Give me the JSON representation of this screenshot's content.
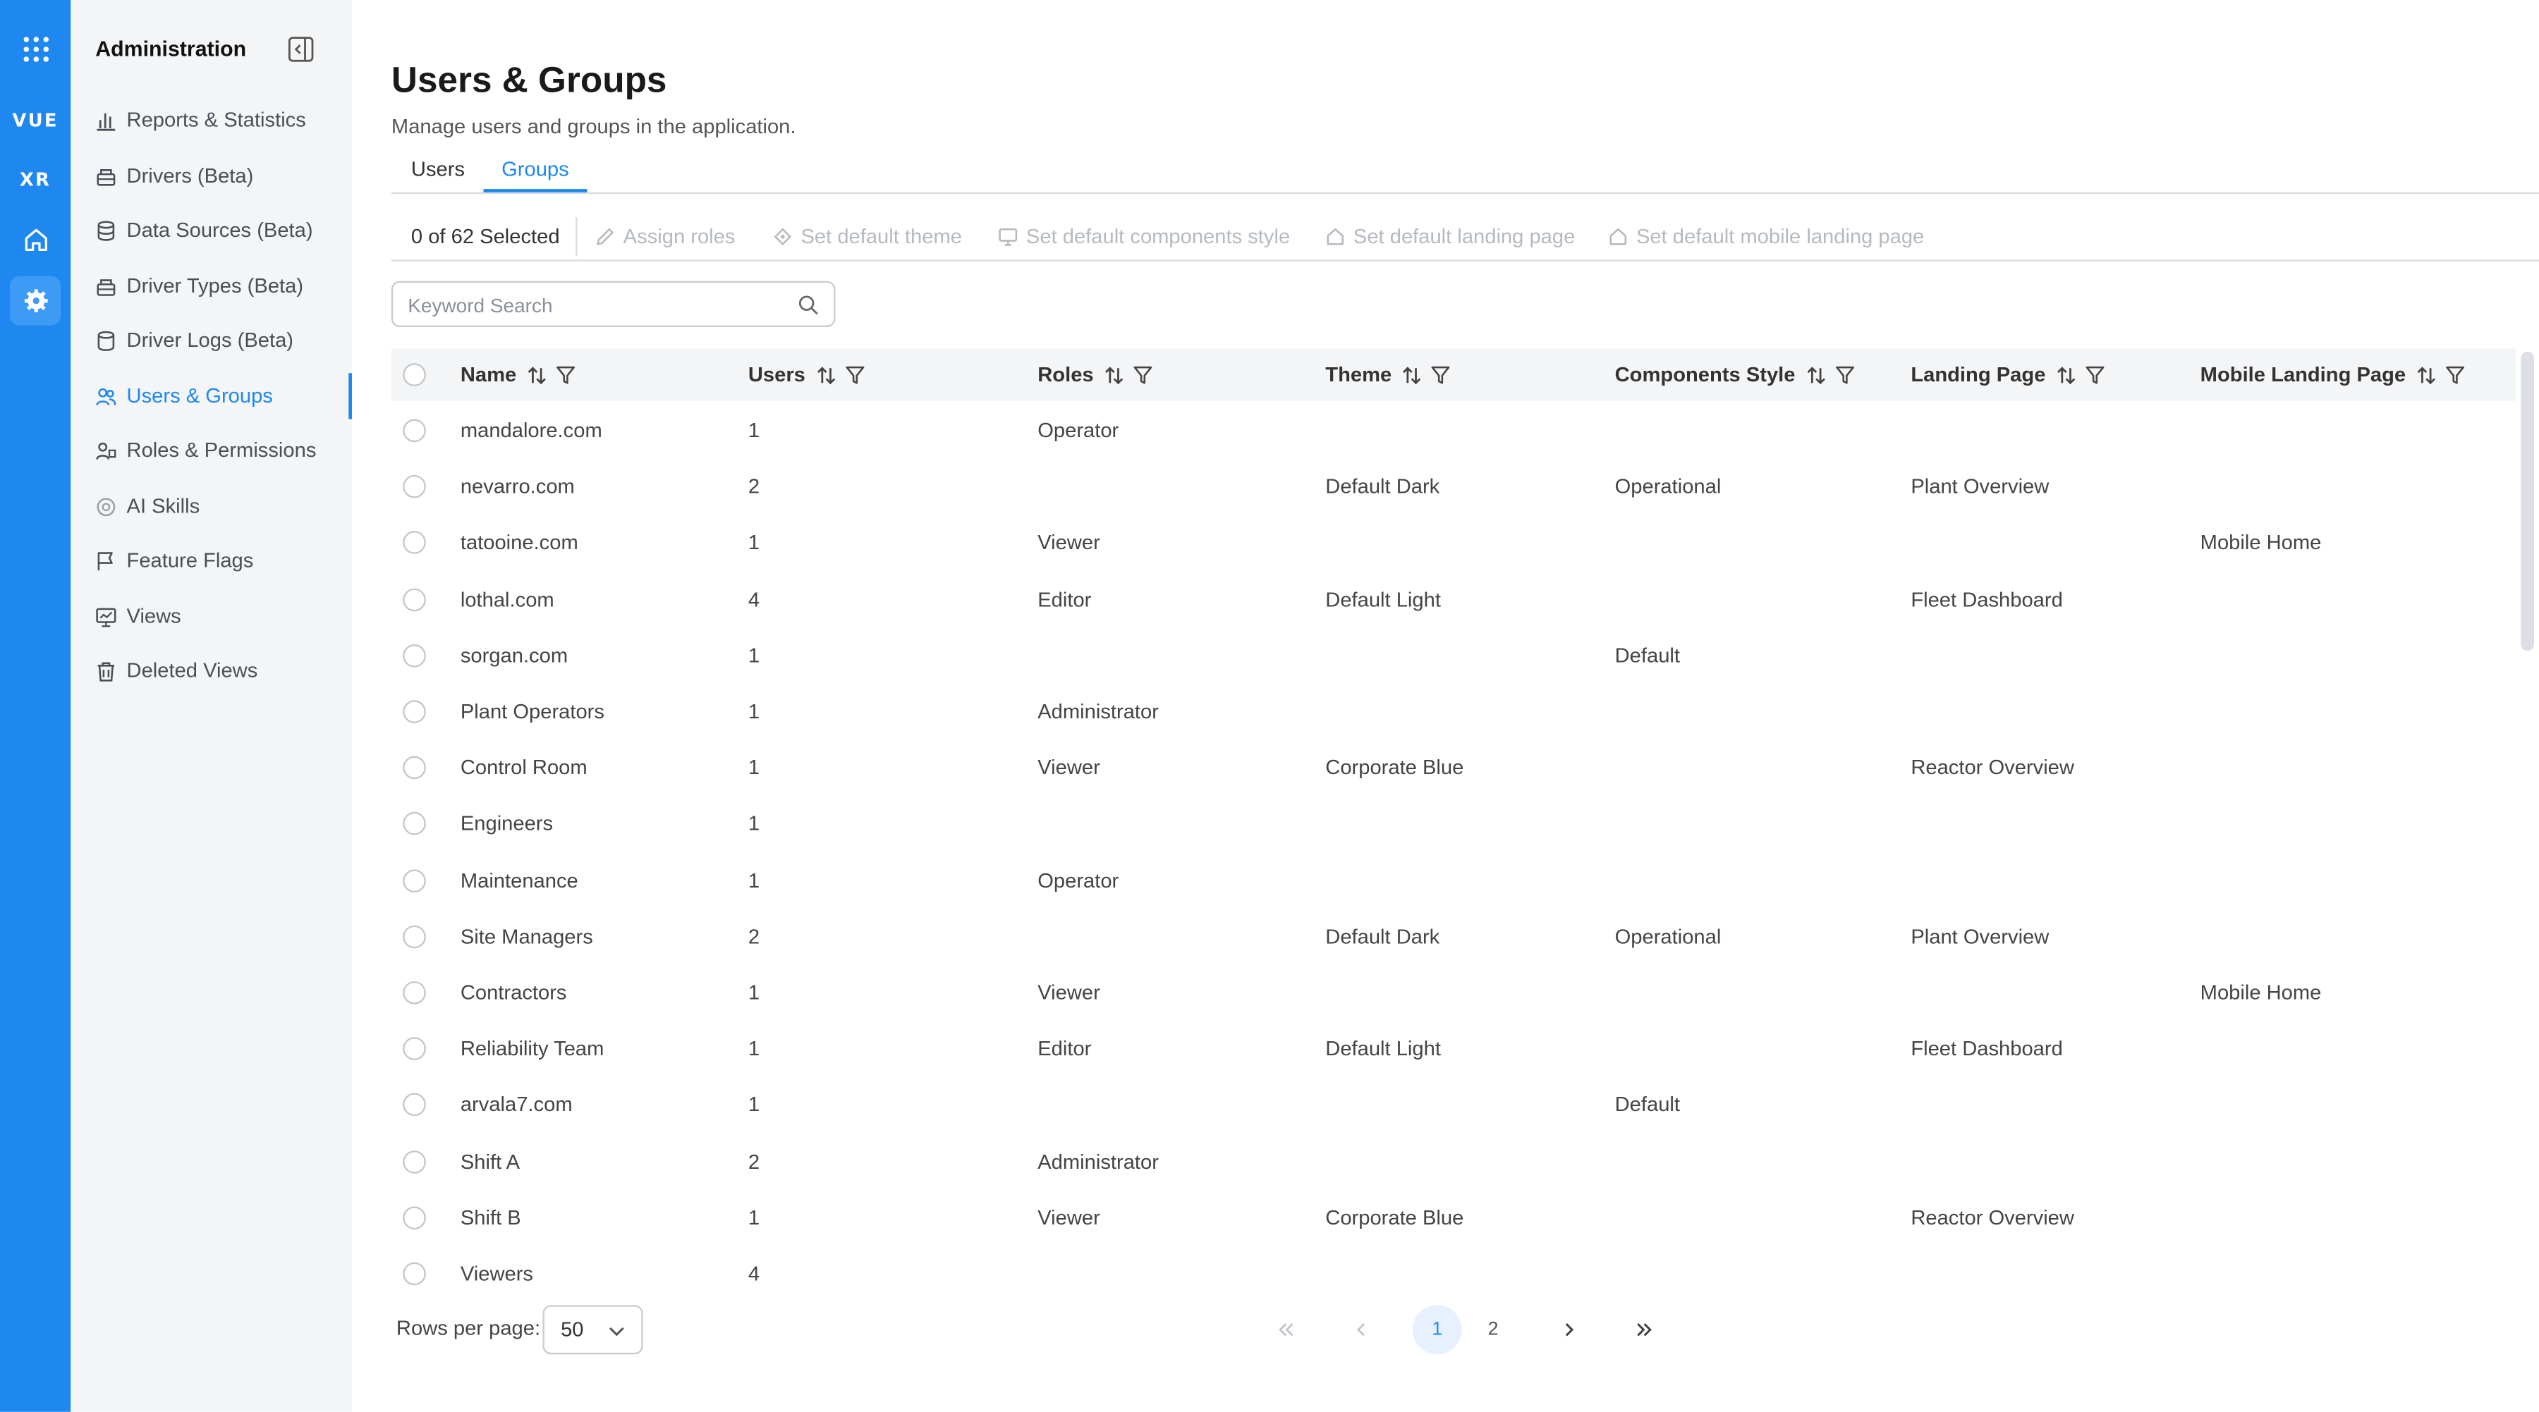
{
  "rail": {
    "items": [
      {
        "name": "apps-grid-icon"
      },
      {
        "label": "VUE"
      },
      {
        "label": "XR"
      },
      {
        "name": "home-icon"
      },
      {
        "name": "gear-icon"
      }
    ]
  },
  "sidebar": {
    "title": "Administration",
    "items": [
      {
        "label": "Reports & Statistics",
        "icon": "bar-chart-icon"
      },
      {
        "label": "Drivers (Beta)",
        "icon": "driver-icon"
      },
      {
        "label": "Data Sources (Beta)",
        "icon": "database-icon"
      },
      {
        "label": "Driver Types (Beta)",
        "icon": "driver-types-icon"
      },
      {
        "label": "Driver Logs (Beta)",
        "icon": "logs-icon"
      },
      {
        "label": "Users & Groups",
        "icon": "users-icon",
        "active": true
      },
      {
        "label": "Roles & Permissions",
        "icon": "roles-icon"
      },
      {
        "label": "AI Skills",
        "icon": "ai-icon"
      },
      {
        "label": "Feature Flags",
        "icon": "flag-icon"
      },
      {
        "label": "Views",
        "icon": "views-icon"
      },
      {
        "label": "Deleted Views",
        "icon": "trash-icon"
      }
    ]
  },
  "page": {
    "title": "Users & Groups",
    "subtitle": "Manage users and groups in the application."
  },
  "tabs": [
    {
      "label": "Users"
    },
    {
      "label": "Groups",
      "active": true
    }
  ],
  "toolbar": {
    "selected": "0 of 62 Selected",
    "actions": [
      {
        "label": "Assign roles",
        "icon": "pencil-icon"
      },
      {
        "label": "Set default theme",
        "icon": "palette-icon"
      },
      {
        "label": "Set default components style",
        "icon": "monitor-icon"
      },
      {
        "label": "Set default landing page",
        "icon": "house-icon"
      },
      {
        "label": "Set default mobile landing page",
        "icon": "house-icon"
      }
    ]
  },
  "search": {
    "placeholder": "Keyword Search"
  },
  "table": {
    "columns": [
      "Name",
      "Users",
      "Roles",
      "Theme",
      "Components Style",
      "Landing Page",
      "Mobile Landing Page"
    ],
    "rows": [
      [
        "mandalore.com",
        "1",
        "Operator",
        "",
        "",
        "",
        ""
      ],
      [
        "nevarro.com",
        "2",
        "",
        "Default Dark",
        "Operational",
        "Plant Overview",
        ""
      ],
      [
        "tatooine.com",
        "1",
        "Viewer",
        "",
        "",
        "",
        "Mobile Home"
      ],
      [
        "lothal.com",
        "4",
        "Editor",
        "Default Light",
        "",
        "Fleet Dashboard",
        ""
      ],
      [
        "sorgan.com",
        "1",
        "",
        "",
        "Default",
        "",
        ""
      ],
      [
        "Plant Operators",
        "1",
        "Administrator",
        "",
        "",
        "",
        ""
      ],
      [
        "Control Room",
        "1",
        "Viewer",
        "Corporate Blue",
        "",
        "Reactor Overview",
        ""
      ],
      [
        "Engineers",
        "1",
        "",
        "",
        "",
        "",
        ""
      ],
      [
        "Maintenance",
        "1",
        "Operator",
        "",
        "",
        "",
        ""
      ],
      [
        "Site Managers",
        "2",
        "",
        "Default Dark",
        "Operational",
        "Plant Overview",
        ""
      ],
      [
        "Contractors",
        "1",
        "Viewer",
        "",
        "",
        "",
        "Mobile Home"
      ],
      [
        "Reliability Team",
        "1",
        "Editor",
        "Default Light",
        "",
        "Fleet Dashboard",
        ""
      ],
      [
        "arvala7.com",
        "1",
        "",
        "",
        "Default",
        "",
        ""
      ],
      [
        "Shift A",
        "2",
        "Administrator",
        "",
        "",
        "",
        ""
      ],
      [
        "Shift B",
        "1",
        "Viewer",
        "Corporate Blue",
        "",
        "Reactor Overview",
        ""
      ],
      [
        "Viewers",
        "4",
        "",
        "",
        "",
        "",
        ""
      ]
    ]
  },
  "footer": {
    "rows_per_page_label": "Rows per page:",
    "rows_per_page": "50",
    "pages": [
      "1",
      "2"
    ],
    "current_page": "1",
    "first": "«",
    "prev": "‹",
    "next": "›",
    "last": "»"
  },
  "colors": {
    "accent": "#1e88f0",
    "rail": "#1e88f0",
    "sidebar_bg": "#f4f5f7"
  }
}
